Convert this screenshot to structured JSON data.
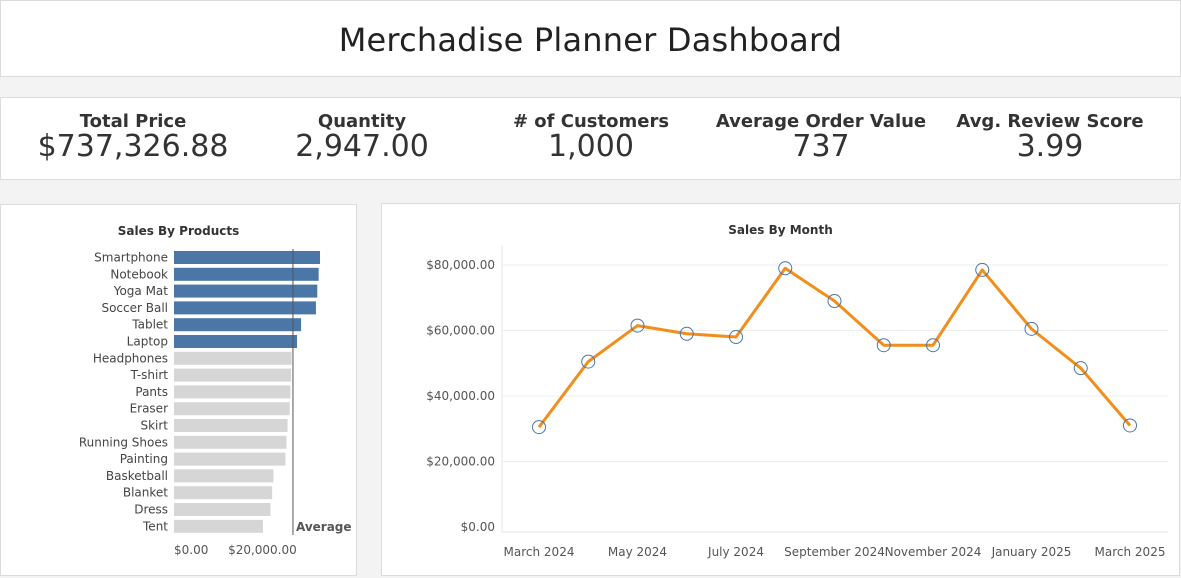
{
  "dashboard": {
    "title": "Merchadise Planner Dashboard"
  },
  "kpis": [
    {
      "label": "Total Price",
      "value": "$737,326.88"
    },
    {
      "label": "Quantity",
      "value": "2,947.00"
    },
    {
      "label": "# of Customers",
      "value": "1,000"
    },
    {
      "label": "Average Order Value",
      "value": "737"
    },
    {
      "label": "Avg. Review Score",
      "value": "3.99"
    }
  ],
  "colors": {
    "highlight_bar": "#4a76a8",
    "normal_bar": "#d6d6d6",
    "line": "#f28e1c",
    "marker": "#4a76a8"
  },
  "chart_data": [
    {
      "type": "bar",
      "orientation": "horizontal",
      "title": "Sales By Products",
      "categories": [
        "Smartphone",
        "Notebook",
        "Yoga Mat",
        "Soccer Ball",
        "Tablet",
        "Laptop",
        "Headphones",
        "T-shirt",
        "Pants",
        "Eraser",
        "Skirt",
        "Running Shoes",
        "Painting",
        "Basketball",
        "Blanket",
        "Dress",
        "Tent"
      ],
      "values": [
        54000,
        53500,
        53000,
        52500,
        47000,
        45500,
        43500,
        43300,
        43100,
        42800,
        42000,
        41600,
        41200,
        36800,
        36300,
        35700,
        32900
      ],
      "highlighted": [
        "Smartphone",
        "Notebook",
        "Yoga Mat",
        "Soccer Ball",
        "Tablet",
        "Laptop"
      ],
      "reference_line": {
        "label": "Average",
        "value": 44000
      },
      "x_ticks": [
        "$0.00",
        "$20,000.00"
      ],
      "xlim": [
        0,
        60000
      ]
    },
    {
      "type": "line",
      "title": "Sales By Month",
      "x": [
        "March 2024",
        "April 2024",
        "May 2024",
        "June 2024",
        "July 2024",
        "August 2024",
        "September 2024",
        "October 2024",
        "November 2024",
        "December 2024",
        "January 2025",
        "February 2025",
        "March 2025"
      ],
      "x_tick_labels": [
        "March 2024",
        "May 2024",
        "July 2024",
        "September 2024",
        "November 2024",
        "January 2025",
        "March 2025"
      ],
      "values": [
        30500,
        50500,
        61500,
        59000,
        58000,
        79000,
        69000,
        55500,
        55500,
        78500,
        60500,
        48500,
        31000
      ],
      "y_ticks": [
        "$0.00",
        "$20,000.00",
        "$40,000.00",
        "$60,000.00",
        "$80,000.00"
      ],
      "ylim": [
        0,
        85000
      ],
      "grid": true
    }
  ]
}
